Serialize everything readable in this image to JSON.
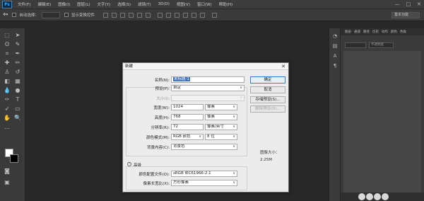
{
  "app": {
    "logo": "Ps"
  },
  "menu": [
    "文件(F)",
    "编辑(E)",
    "图像(I)",
    "图层(L)",
    "文字(Y)",
    "选择(S)",
    "滤镜(T)",
    "3D(D)",
    "视图(V)",
    "窗口(W)",
    "帮助(H)"
  ],
  "window_controls": {
    "minimize": "—",
    "maximize": "□",
    "close": "✕"
  },
  "options_bar": {
    "auto_select_label": "自动选择：",
    "show_transform_label": "显示变换控件",
    "workspace": "基本功能"
  },
  "panel": {
    "tabs": [
      "图层",
      "通道",
      "路径",
      "历史",
      "动作",
      "颜色",
      "色板"
    ],
    "blend_placeholder": "不透明度"
  },
  "dialog": {
    "title": "新建",
    "close": "✕",
    "name_label": "名称(N):",
    "name_value": "未标题-1",
    "preset_label": "预设(P):",
    "preset_value": "自定",
    "size_label": "大小(I):",
    "width_label": "宽度(W):",
    "width_value": "1024",
    "width_unit": "像素",
    "height_label": "高度(H):",
    "height_value": "768",
    "height_unit": "像素",
    "resolution_label": "分辨率(R):",
    "resolution_value": "72",
    "resolution_unit": "像素/英寸",
    "color_mode_label": "颜色模式(M):",
    "color_mode_value": "RGB 颜色",
    "bit_depth_value": "8 位",
    "bg_contents_label": "背景内容(C):",
    "bg_contents_value": "背景色",
    "advanced_label": "高级",
    "color_profile_label": "颜色配置文件(O):",
    "color_profile_value": "sRGB IEC61966-2.1",
    "pixel_aspect_label": "像素长宽比(X):",
    "pixel_aspect_value": "方形像素",
    "ok_button": "确定",
    "cancel_button": "取消",
    "save_preset_button": "存储预设(S)...",
    "delete_preset_button": "删除预设(D)...",
    "image_size_label": "图像大小：",
    "image_size_value": "2.25M"
  }
}
